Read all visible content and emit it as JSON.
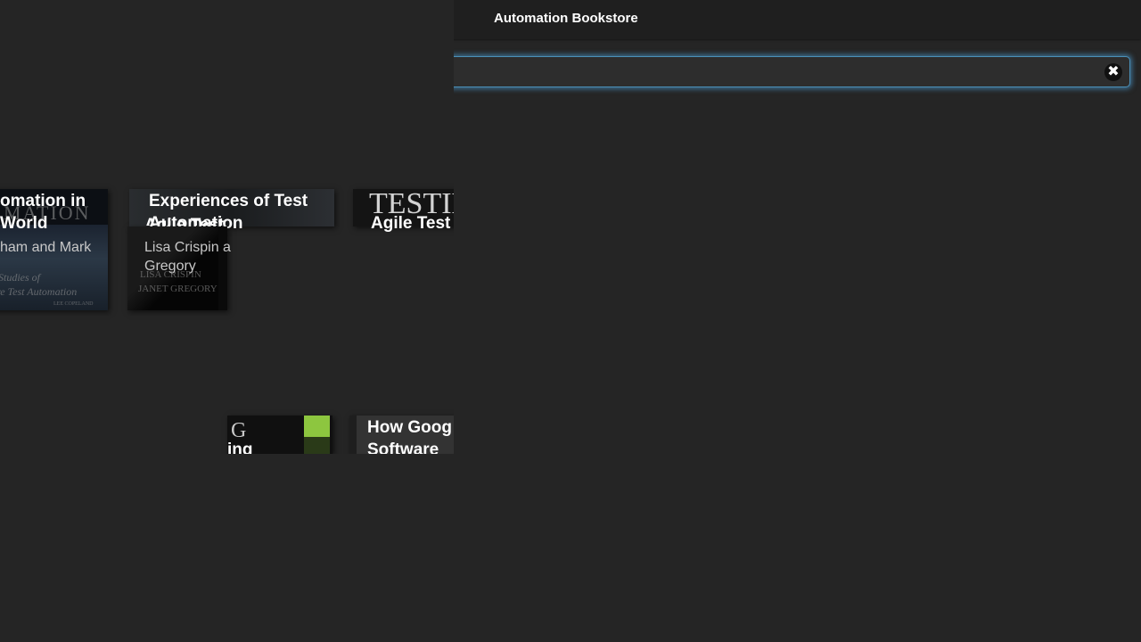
{
  "header": {
    "title": "Automation Bookstore"
  },
  "search": {
    "value": "",
    "clear_icon": "close-icon",
    "clear_glyph": "✖"
  },
  "books": [
    {
      "title_line1": "omation in",
      "title_line2": "World",
      "author": "ham and Mark",
      "cover_text_top": "MATION",
      "cover_text_line1": "Studies of",
      "cover_text_line2": "re Test Automation",
      "cover_text_foot": "LEE COPELAND"
    },
    {
      "title_line1": "Experiences of Test",
      "title_line2": "Automation"
    },
    {
      "title_line1": "Agile Test",
      "cover_text_top": "TESTIN"
    },
    {
      "title_line1": "Agile Test",
      "author_line1": "Lisa Crispin a",
      "author_line2": "Gregory",
      "cover_text_line1": "LISA CRISPIN",
      "cover_text_line2": "JANET GREGORY"
    },
    {
      "cover_text_top": "G",
      "title_line1": "ing"
    },
    {
      "title_line1": "How Goog",
      "title_line2": "Software"
    }
  ],
  "colors": {
    "background": "#252525",
    "header": "#1f1f1f",
    "focus_glow": "#50aae6",
    "accent_green": "#8dc63f"
  }
}
